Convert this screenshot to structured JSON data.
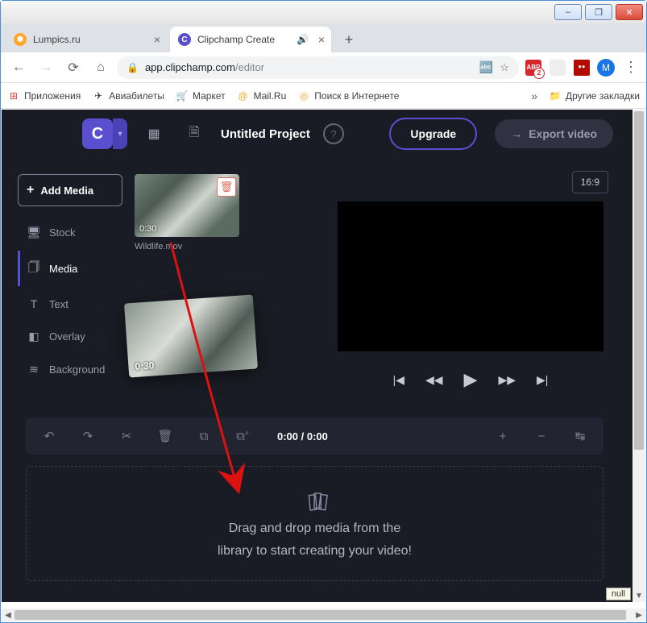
{
  "window": {
    "minimize": "–",
    "maximize": "❐",
    "close": "✕"
  },
  "tabs": {
    "t0": {
      "title": "Lumpics.ru",
      "fav": "✽"
    },
    "t1": {
      "title": "Clipchamp Create",
      "fav": "C"
    },
    "new": "+"
  },
  "nav": {
    "back": "←",
    "forward": "→",
    "reload": "⟳",
    "home": "⌂"
  },
  "url": {
    "lock": "🔒",
    "host": "app.clipchamp.com",
    "path": "/editor",
    "translate": "⠿",
    "star": "☆"
  },
  "ext": {
    "abp": "ABP",
    "adobe": "A",
    "avatar": "М",
    "more": "⋮"
  },
  "bookmarks": {
    "apps": "Приложения",
    "avia": "Авиабилеты",
    "market": "Маркет",
    "mail": "Mail.Ru",
    "search": "Поиск в Интернете",
    "more": "»",
    "other": "Другие закладки"
  },
  "app": {
    "logo": "C",
    "project": "Untitled Project",
    "help": "?",
    "upgrade": "Upgrade",
    "export": "Export video",
    "export_arrow": "→"
  },
  "side": {
    "add": "Add Media",
    "plus": "+",
    "stock": "Stock",
    "media": "Media",
    "text": "Text",
    "overlay": "Overlay",
    "background": "Background"
  },
  "media": {
    "duration": "0:30",
    "name": "Wildlife.mov",
    "ghost_dur": "0:30",
    "delete": "🗑"
  },
  "preview": {
    "aspect": "16:9",
    "prev_full": "|◀",
    "rew": "◀◀",
    "play": "▶",
    "ffwd": "▶▶",
    "next_full": "▶|"
  },
  "timeline": {
    "undo": "↶",
    "redo": "↷",
    "cut": "✂",
    "trash": "🗑",
    "dup": "⧉",
    "group": "⧉⁺",
    "time": "0:00 / 0:00",
    "plus": "+",
    "minus": "−",
    "fit": "↹"
  },
  "dropzone": {
    "line1": "Drag and drop media from the",
    "line2": "library to start creating your video!"
  },
  "null_tag": "null"
}
